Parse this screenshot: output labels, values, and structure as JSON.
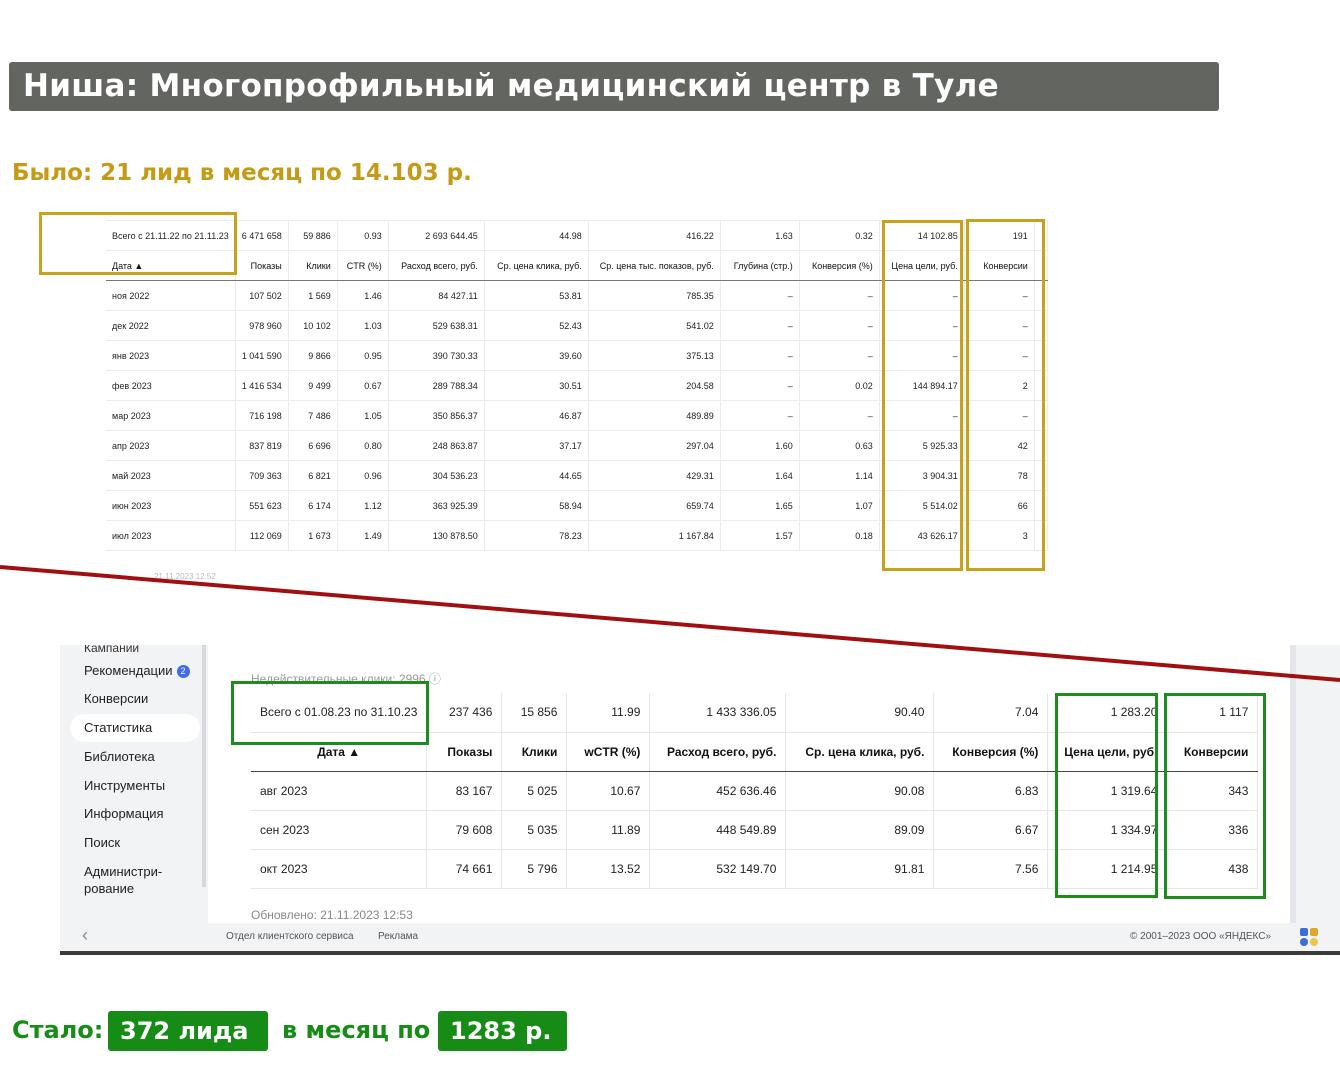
{
  "title": "Ниша: Многопрофильный медицинский центр в Туле",
  "before": {
    "text": "Было: 21 лид в месяц по 14.103 р."
  },
  "old_table": {
    "total_label": "Всего с 21.11.22 по 21.11.23",
    "totals": [
      "6 471 658",
      "59 886",
      "0.93",
      "2 693 644.45",
      "44.98",
      "416.22",
      "1.63",
      "0.32",
      "14 102.85",
      "191"
    ],
    "headers": [
      "Дата ▲",
      "Показы",
      "Клики",
      "CTR (%)",
      "Расход всего, руб.",
      "Ср. цена клика, руб.",
      "Ср. цена тыс. показов, руб.",
      "Глубина (стр.)",
      "Конверсия (%)",
      "Цена цели, руб.",
      "Конверсии"
    ],
    "rows": [
      [
        "ноя 2022",
        "107 502",
        "1 569",
        "1.46",
        "84 427.11",
        "53.81",
        "785.35",
        "–",
        "–",
        "–",
        "–"
      ],
      [
        "дек 2022",
        "978 960",
        "10 102",
        "1.03",
        "529 638.31",
        "52.43",
        "541.02",
        "–",
        "–",
        "–",
        "–"
      ],
      [
        "янв 2023",
        "1 041 590",
        "9 866",
        "0.95",
        "390 730.33",
        "39.60",
        "375.13",
        "–",
        "–",
        "–",
        "–"
      ],
      [
        "фев 2023",
        "1 416 534",
        "9 499",
        "0.67",
        "289 788.34",
        "30.51",
        "204.58",
        "–",
        "0.02",
        "144 894.17",
        "2"
      ],
      [
        "мар 2023",
        "716 198",
        "7 486",
        "1.05",
        "350 856.37",
        "46.87",
        "489.89",
        "–",
        "–",
        "–",
        "–"
      ],
      [
        "апр 2023",
        "837 819",
        "6 696",
        "0.80",
        "248 863.87",
        "37.17",
        "297.04",
        "1.60",
        "0.63",
        "5 925.33",
        "42"
      ],
      [
        "май 2023",
        "709 363",
        "6 821",
        "0.96",
        "304 536.23",
        "44.65",
        "429.31",
        "1.64",
        "1.14",
        "3 904.31",
        "78"
      ],
      [
        "июн 2023",
        "551 623",
        "6 174",
        "1.12",
        "363 925.39",
        "58.94",
        "659.74",
        "1.65",
        "1.07",
        "5 514.02",
        "66"
      ],
      [
        "июл 2023",
        "112 069",
        "1 673",
        "1.49",
        "130 878.50",
        "78.23",
        "1 167.84",
        "1.57",
        "0.18",
        "43 626.17",
        "3"
      ]
    ],
    "faded_date": "21.11.2023 12:52"
  },
  "sidebar": {
    "cut_label": "Кампании",
    "items": [
      {
        "label": "Рекомендации",
        "badge": "2"
      },
      {
        "label": "Конверсии"
      },
      {
        "label": "Статистика"
      },
      {
        "label": "Библиотека"
      },
      {
        "label": "Инструменты"
      },
      {
        "label": "Информация"
      },
      {
        "label": "Поиск"
      },
      {
        "label": "Администри-\nрование"
      }
    ]
  },
  "new_table": {
    "invalid_clicks": "Недействительные клики: 2996 ⓘ",
    "total_label": "Всего с 01.08.23 по 31.10.23",
    "totals": [
      "237 436",
      "15 856",
      "11.99",
      "1 433 336.05",
      "90.40",
      "7.04",
      "1 283.20",
      "1 117"
    ],
    "headers": [
      "Дата ▲",
      "Показы",
      "Клики",
      "wCTR (%)",
      "Расход всего, руб.",
      "Ср. цена клика, руб.",
      "Конверсия (%)",
      "Цена цели, руб.",
      "Конверсии"
    ],
    "rows": [
      [
        "авг 2023",
        "83 167",
        "5 025",
        "10.67",
        "452 636.46",
        "90.08",
        "6.83",
        "1 319.64",
        "343"
      ],
      [
        "сен 2023",
        "79 608",
        "5 035",
        "11.89",
        "448 549.89",
        "89.09",
        "6.67",
        "1 334.97",
        "336"
      ],
      [
        "окт 2023",
        "74 661",
        "5 796",
        "13.52",
        "532 149.70",
        "91.81",
        "7.56",
        "1 214.95",
        "438"
      ]
    ],
    "updated": "Обновлено: 21.11.2023 12:53"
  },
  "footer": {
    "chevron": "‹",
    "client_service": "Отдел клиентского сервиса",
    "ads": "Реклама",
    "copyright": "© 2001–2023 ООО «ЯНДЕКС»"
  },
  "after": {
    "prefix": "Стало:",
    "leads": "372 лида",
    "middle": "в месяц по",
    "price": "1283 р."
  },
  "colors": {
    "gold": "#c9a21c",
    "green": "#168c16",
    "red_line": "#a01010",
    "title_bg": "#636560"
  }
}
